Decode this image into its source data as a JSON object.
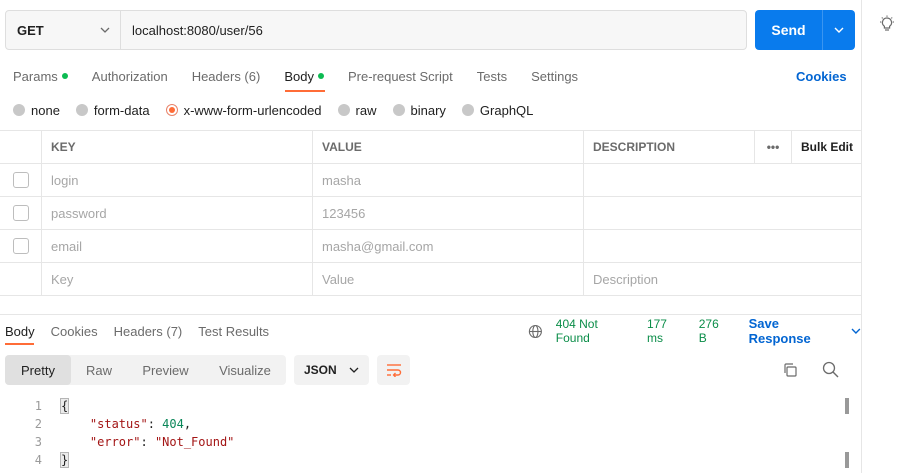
{
  "request": {
    "method": "GET",
    "url": "localhost:8080/user/56",
    "send_label": "Send"
  },
  "request_tabs": [
    {
      "label": "Params",
      "dot": true
    },
    {
      "label": "Authorization",
      "dot": false
    },
    {
      "label": "Headers (6)",
      "dot": false
    },
    {
      "label": "Body",
      "dot": true,
      "active": true
    },
    {
      "label": "Pre-request Script",
      "dot": false
    },
    {
      "label": "Tests",
      "dot": false
    },
    {
      "label": "Settings",
      "dot": false
    }
  ],
  "cookies_label": "Cookies",
  "body_types": [
    {
      "label": "none",
      "selected": false
    },
    {
      "label": "form-data",
      "selected": false
    },
    {
      "label": "x-www-form-urlencoded",
      "selected": true
    },
    {
      "label": "raw",
      "selected": false
    },
    {
      "label": "binary",
      "selected": false
    },
    {
      "label": "GraphQL",
      "selected": false
    }
  ],
  "params_table": {
    "headers": {
      "key": "KEY",
      "value": "VALUE",
      "description": "DESCRIPTION",
      "more": "•••",
      "bulk_edit": "Bulk Edit"
    },
    "rows": [
      {
        "key": "login",
        "value": "masha",
        "description": ""
      },
      {
        "key": "password",
        "value": "123456",
        "description": ""
      },
      {
        "key": "email",
        "value": "masha@gmail.com",
        "description": ""
      }
    ],
    "placeholder": {
      "key": "Key",
      "value": "Value",
      "description": "Description"
    }
  },
  "response_tabs": [
    {
      "label": "Body",
      "active": true
    },
    {
      "label": "Cookies"
    },
    {
      "label": "Headers (7)"
    },
    {
      "label": "Test Results"
    }
  ],
  "response_status": {
    "status": "404 Not Found",
    "time": "177 ms",
    "size": "276 B",
    "save_label": "Save Response",
    "status_color": "#0a8d48"
  },
  "view_modes": [
    {
      "label": "Pretty",
      "active": true
    },
    {
      "label": "Raw"
    },
    {
      "label": "Preview"
    },
    {
      "label": "Visualize"
    }
  ],
  "format": "JSON",
  "code_lines": [
    {
      "n": "1",
      "text": "{"
    },
    {
      "n": "2",
      "key": "\"status\"",
      "value": "404"
    },
    {
      "n": "3",
      "key": "\"error\"",
      "value": "\"Not_Found\""
    },
    {
      "n": "4",
      "text": "}"
    }
  ],
  "colors": {
    "accent": "#ff6c37",
    "send": "#097bed",
    "link": "#0265d2"
  }
}
